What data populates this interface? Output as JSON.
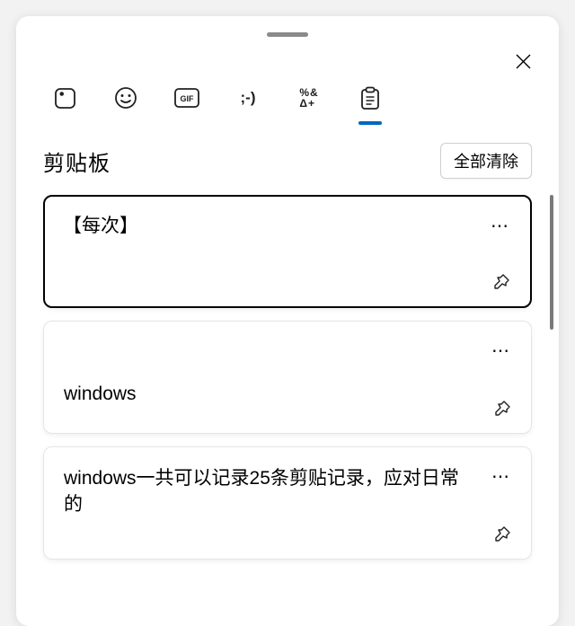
{
  "header": {
    "title": "剪贴板",
    "clear_all": "全部清除"
  },
  "tabs": [
    {
      "id": "stickers"
    },
    {
      "id": "emoji"
    },
    {
      "id": "gif"
    },
    {
      "id": "kaomoji"
    },
    {
      "id": "symbols"
    },
    {
      "id": "clipboard",
      "active": true
    }
  ],
  "items": [
    {
      "text": "【每次】",
      "selected": true
    },
    {
      "text": "windows"
    },
    {
      "text": "windows一共可以记录25条剪贴记录，应对日常的"
    }
  ],
  "more": "⋯"
}
